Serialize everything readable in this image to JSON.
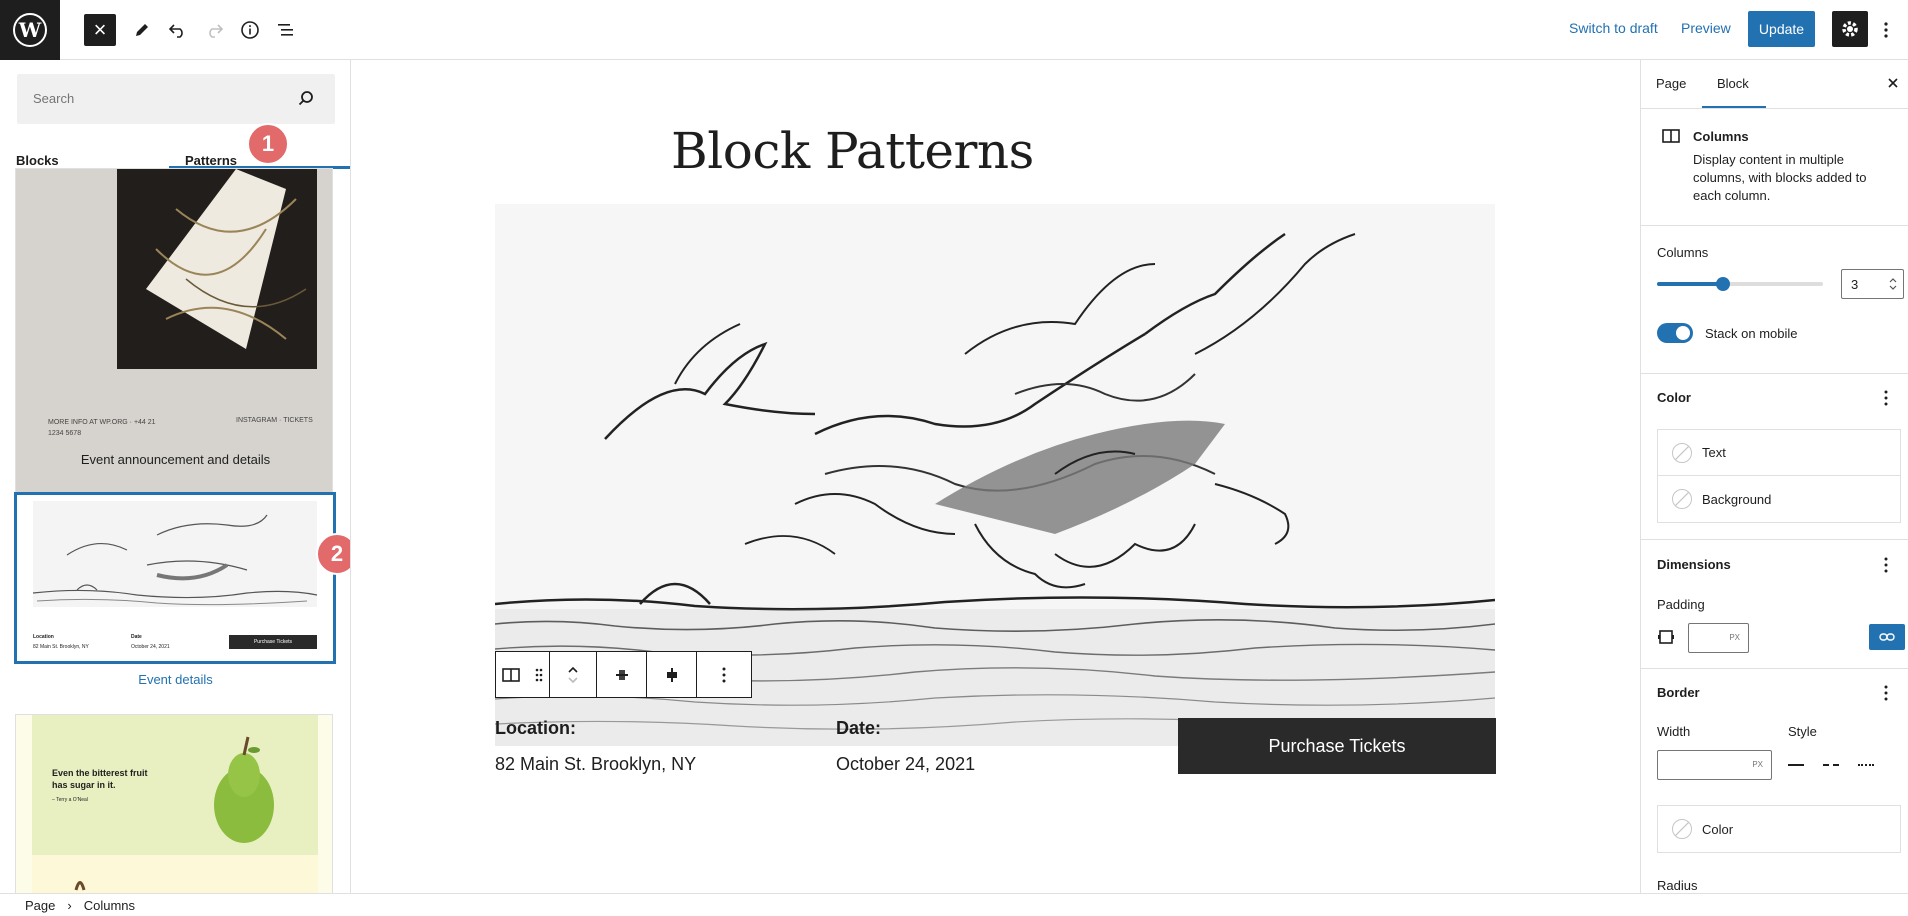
{
  "topbar": {
    "close_label": "×",
    "switch_to_draft": "Switch to draft",
    "preview": "Preview",
    "update": "Update"
  },
  "inserter": {
    "search_placeholder": "Search",
    "tabs": {
      "blocks": "Blocks",
      "patterns": "Patterns"
    },
    "badges": {
      "one": "1",
      "two": "2"
    },
    "patterns": [
      {
        "label": "Event announcement and details",
        "thumb_text_left": "MORE INFO AT WP.ORG · +44 21 1234 5678",
        "thumb_text_right": "INSTAGRAM · TICKETS"
      },
      {
        "label": "Event details",
        "thumb_location": "Location",
        "thumb_address": "82 Main St. Brooklyn, NY",
        "thumb_date": "Date",
        "thumb_date_value": "October 24, 2021",
        "thumb_button": "Purchase Tickets"
      },
      {
        "label": "",
        "quote_line1": "Even the bitterest fruit",
        "quote_line2": "has sugar in it.",
        "quote_author": "– Terry a O'Neal"
      }
    ]
  },
  "canvas": {
    "title": "Block Patterns",
    "location_label": "Location:",
    "location_value": "82 Main St. Brooklyn, NY",
    "date_label": "Date:",
    "date_value": "October 24, 2021",
    "purchase_button": "Purchase Tickets"
  },
  "sidebar": {
    "tabs": {
      "page": "Page",
      "block": "Block"
    },
    "block_name": "Columns",
    "block_description_1": "Display content in multiple",
    "block_description_2": "columns, with blocks added to",
    "block_description_3": "each column.",
    "columns_label": "Columns",
    "columns_value": "3",
    "columns_slider_fraction": 0.4,
    "stack_on_mobile": "Stack on mobile",
    "stack_on_mobile_on": true,
    "color_title": "Color",
    "color_text": "Text",
    "color_background": "Background",
    "dimensions_title": "Dimensions",
    "padding_label": "Padding",
    "px_unit": "PX",
    "border_title": "Border",
    "width_label": "Width",
    "style_label": "Style",
    "border_color": "Color",
    "radius_label": "Radius"
  },
  "footer": {
    "crumb_page": "Page",
    "crumb_separator": "›",
    "crumb_columns": "Columns"
  },
  "colors": {
    "accent": "#2271b1",
    "dark": "#1e1e1e",
    "badge": "#e26a6a"
  }
}
